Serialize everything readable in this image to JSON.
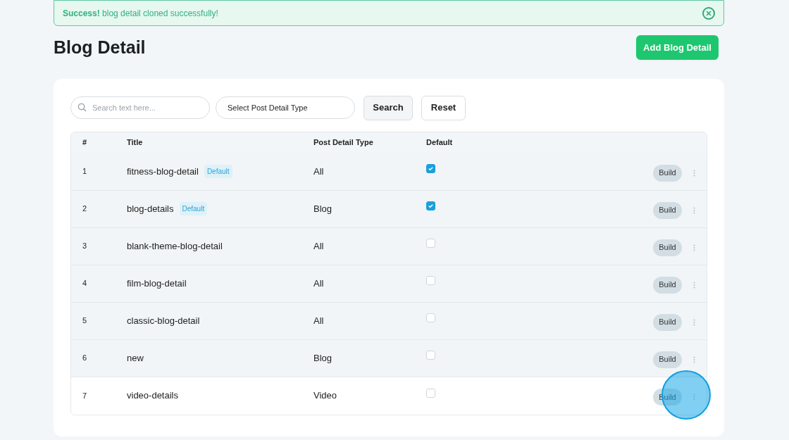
{
  "alert": {
    "text": "**Success!** blog detail cloned successfully!"
  },
  "page_title": "Blog Detail",
  "add_button": "Add Blog Detail",
  "filters": {
    "search": {
      "placeholder": "Search text here..."
    },
    "type_select": {
      "value": "Select Post Detail Type"
    },
    "buttons": [
      "Search",
      "Reset"
    ]
  },
  "table": {
    "columns": [
      "#",
      "Title",
      "Post Detail Type",
      "Default"
    ],
    "rows": [
      {
        "index": "1",
        "title": "fitness-blog-detail",
        "badge": "Default",
        "type": "All",
        "checked": true,
        "shaded": true,
        "action": "Build"
      },
      {
        "index": "2",
        "title": "blog-details",
        "badge": "Default",
        "type": "Blog",
        "checked": true,
        "shaded": true,
        "action": "Build"
      },
      {
        "index": "3",
        "title": "blank-theme-blog-detail",
        "type": "All",
        "checked": false,
        "shaded": true,
        "action": "Build"
      },
      {
        "index": "4",
        "title": "film-blog-detail",
        "type": "All",
        "checked": false,
        "shaded": true,
        "action": "Build"
      },
      {
        "index": "5",
        "title": "classic-blog-detail",
        "type": "All",
        "checked": false,
        "shaded": true,
        "action": "Build"
      },
      {
        "index": "6",
        "title": "new",
        "type": "Blog",
        "checked": false,
        "shaded": true,
        "action": "Build"
      },
      {
        "index": "7",
        "title": "video-details",
        "type": "Video",
        "checked": false,
        "shaded": false,
        "action": "Build"
      }
    ]
  }
}
